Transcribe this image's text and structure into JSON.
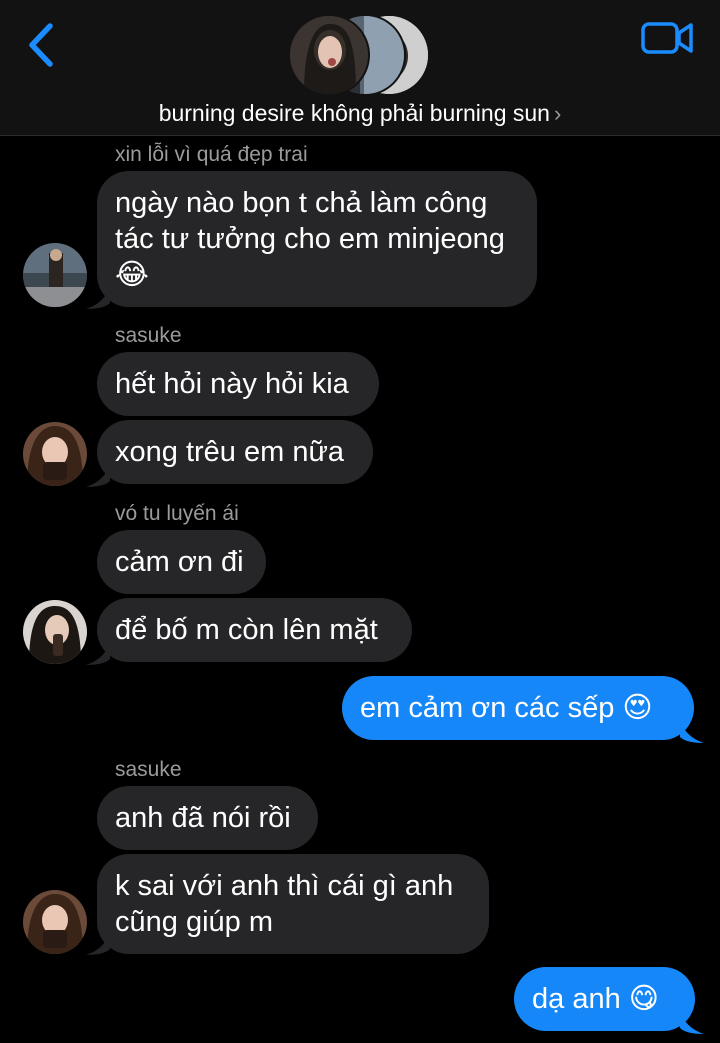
{
  "header": {
    "title": "burning desire không phải burning sun",
    "chevron": "›",
    "accent": "#1a8cff"
  },
  "messages": [
    {
      "sender": "xin lỗi vì quá đẹp trai",
      "text": "ngày nào bọn t chả làm công tác tư tưởng cho em minjeong 😂"
    },
    {
      "sender": "sasuke",
      "text": "hết hỏi này hỏi kia"
    },
    {
      "text": "xong trêu em nữa"
    },
    {
      "sender": "vó tu luyến ái",
      "text": "cảm ơn đi"
    },
    {
      "text": "để bố m còn lên mặt"
    },
    {
      "text": "em cảm ơn các sếp 😍",
      "outgoing": true
    },
    {
      "sender": "sasuke",
      "text": "anh đã nói rồi"
    },
    {
      "text": "k sai với anh thì cái gì anh cũng giúp m"
    },
    {
      "text": "dạ anh 😋",
      "outgoing": true
    }
  ],
  "colors": {
    "incoming_bubble": "#262628",
    "outgoing_bubble": "#1687f8",
    "background": "#000000",
    "sender_label": "#9b9b9b"
  },
  "icons": [
    "back-chevron-icon",
    "video-camera-icon"
  ]
}
